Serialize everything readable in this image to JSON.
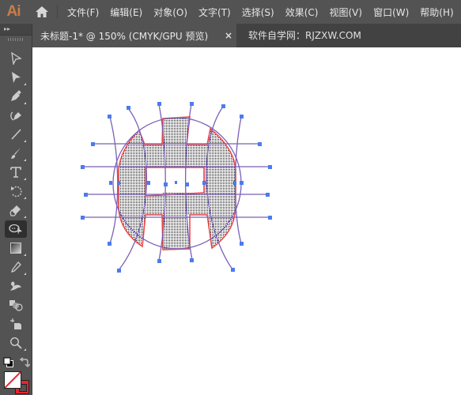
{
  "app": {
    "logo": "Ai",
    "home_icon": "home-icon"
  },
  "menu": [
    {
      "label": "文件(F)"
    },
    {
      "label": "编辑(E)"
    },
    {
      "label": "对象(O)"
    },
    {
      "label": "文字(T)"
    },
    {
      "label": "选择(S)"
    },
    {
      "label": "效果(C)"
    },
    {
      "label": "视图(V)"
    },
    {
      "label": "窗口(W)"
    },
    {
      "label": "帮助(H)"
    }
  ],
  "toolbar": {
    "collapse_label": "▸▸",
    "tools": [
      {
        "name": "selection-tool",
        "icon": "hollow-arrow-icon"
      },
      {
        "name": "direct-selection-tool",
        "icon": "arrow-icon"
      },
      {
        "name": "pen-tool",
        "icon": "pen-icon"
      },
      {
        "name": "curvature-tool",
        "icon": "curvature-pen-icon"
      },
      {
        "name": "line-tool",
        "icon": "line-icon"
      },
      {
        "name": "paintbrush-tool",
        "icon": "brush-icon"
      },
      {
        "name": "type-tool",
        "icon": "type-icon"
      },
      {
        "name": "rotate-tool",
        "icon": "rotate-icon"
      },
      {
        "name": "eraser-tool",
        "icon": "eraser-icon"
      },
      {
        "name": "lasso-select-tool",
        "icon": "lasso-icon",
        "active": true
      },
      {
        "name": "gradient-tool",
        "icon": "gradient-icon"
      },
      {
        "name": "eyedropper-tool",
        "icon": "eyedropper-icon"
      },
      {
        "name": "puppet-warp-tool",
        "icon": "puppet-icon"
      },
      {
        "name": "shape-builder-tool",
        "icon": "shape-builder-icon"
      },
      {
        "name": "artboard-tool",
        "icon": "artboard-icon"
      },
      {
        "name": "zoom-tool",
        "icon": "zoom-icon"
      }
    ],
    "fill_stroke": {
      "fill": "none",
      "stroke_color": "#e8252d"
    }
  },
  "tabs": [
    {
      "title": "未标题-1* @ 150% (CMYK/GPU 预览)",
      "close": "×",
      "active": true
    },
    {
      "title": "软件自学网：RJZXW.COM",
      "active": false
    }
  ],
  "artwork": {
    "selection_color": "#4a7cf0",
    "path_color": "#7a5fb8",
    "highlight_color": "#f04a4a",
    "fill_pattern": "dotted-grid"
  }
}
